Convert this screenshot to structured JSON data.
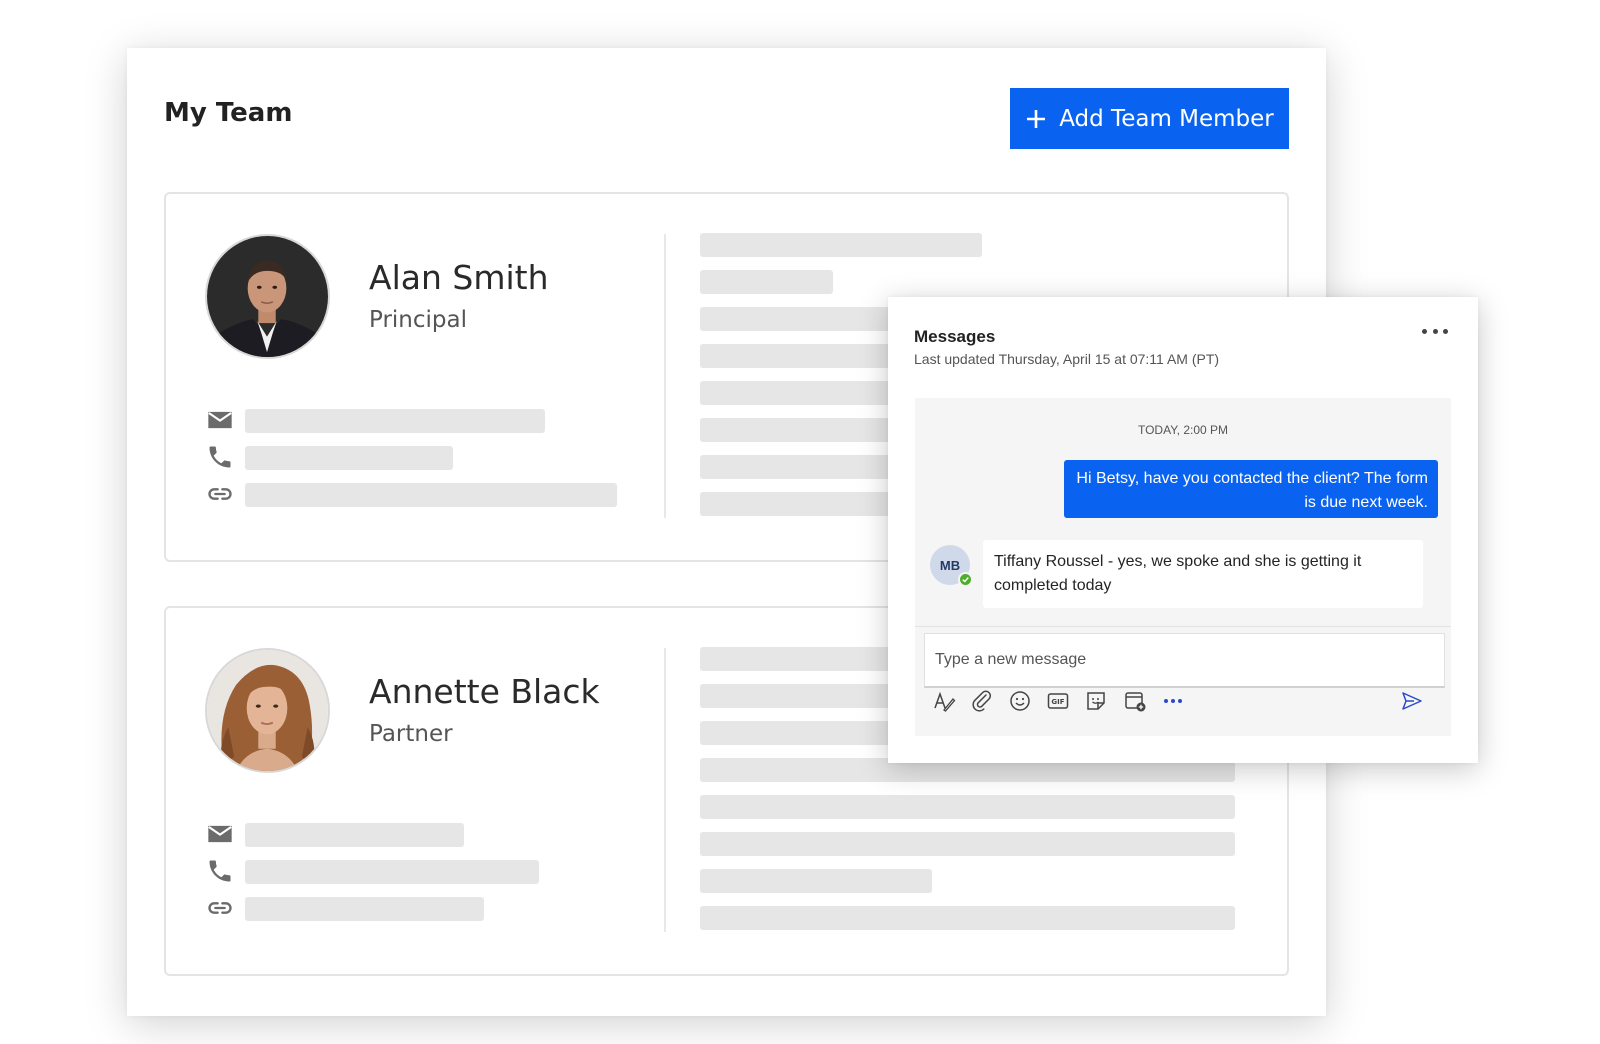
{
  "header": {
    "title": "My Team",
    "add_button_label": "Add Team Member"
  },
  "members": [
    {
      "name": "Alan Smith",
      "role": "Principal"
    },
    {
      "name": "Annette Black",
      "role": "Partner"
    }
  ],
  "messages": {
    "title": "Messages",
    "last_updated": "Last updated Thursday, April 15 at 07:11 AM (PT)",
    "timestamp": "TODAY, 2:00 PM",
    "outgoing": "Hi Betsy, have you contacted the client? The form is due next week.",
    "sender_initials": "MB",
    "incoming": "Tiffany Roussel - yes, we spoke and she is getting it completed today",
    "compose_placeholder": "Type a new message"
  },
  "icons": {
    "add": "plus-icon",
    "contact": [
      "mail-icon",
      "phone-icon",
      "link-icon"
    ],
    "toolbar": [
      "format-icon",
      "attach-icon",
      "emoji-icon",
      "gif-icon",
      "sticker-icon",
      "schedule-meeting-icon",
      "more-icon"
    ],
    "send": "send-icon",
    "menu": "more-options-icon",
    "status": "available-check-icon"
  },
  "colors": {
    "accent": "#0a63f0",
    "skeleton": "#e6e6e6",
    "status_available": "#4caf2a",
    "chat_background": "#f5f5f5"
  }
}
